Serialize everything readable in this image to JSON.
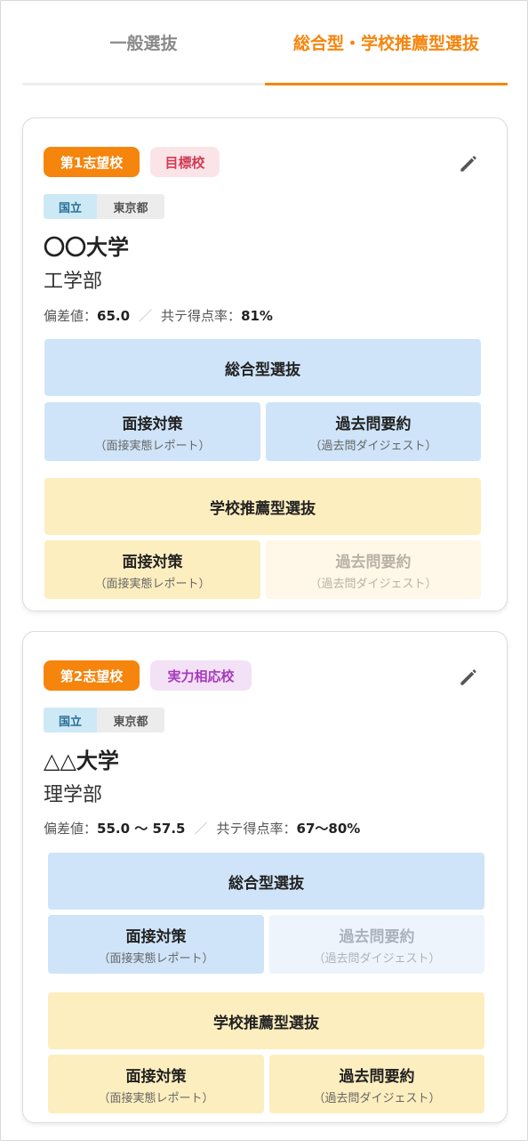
{
  "tabs": {
    "general": "一般選抜",
    "comprehensive": "総合型・学校推薦型選抜",
    "active": "comprehensive"
  },
  "colors": {
    "accent": "#f5850d",
    "blue_block": "#cfe4f8",
    "yellow_block": "#fdeebf"
  },
  "cards": [
    {
      "choice_label": "第1志望校",
      "category_label": "目標校",
      "edit_icon": "pencil-icon",
      "type_tag": "国立",
      "prefecture_tag": "東京都",
      "university": "〇〇大学",
      "faculty": "工学部",
      "deviation_label": "偏差値：",
      "deviation_value": "65.0",
      "common_test_label": "共テ得点率：",
      "common_test_value": "81%",
      "comprehensive": {
        "title": "総合型選抜",
        "interview_title": "面接対策",
        "interview_sub": "（面接実態レポート）",
        "past_title": "過去問要約",
        "past_sub": "（過去問ダイジェスト）"
      },
      "recommendation": {
        "title": "学校推薦型選抜",
        "interview_title": "面接対策",
        "interview_sub": "（面接実態レポート）",
        "past_title": "過去問要約",
        "past_sub": "（過去問ダイジェスト）"
      }
    },
    {
      "choice_label": "第2志望校",
      "category_label": "実力相応校",
      "edit_icon": "pencil-icon",
      "type_tag": "国立",
      "prefecture_tag": "東京都",
      "university": "△△大学",
      "faculty": "理学部",
      "deviation_label": "偏差値：",
      "deviation_value": "55.0 〜 57.5",
      "common_test_label": "共テ得点率：",
      "common_test_value": "67〜80%",
      "comprehensive": {
        "title": "総合型選抜",
        "interview_title": "面接対策",
        "interview_sub": "（面接実態レポート）",
        "past_title": "過去問要約",
        "past_sub": "（過去問ダイジェスト）"
      },
      "recommendation": {
        "title": "学校推薦型選抜",
        "interview_title": "面接対策",
        "interview_sub": "（面接実態レポート）",
        "past_title": "過去問要約",
        "past_sub": "（過去問ダイジェスト）"
      }
    }
  ]
}
